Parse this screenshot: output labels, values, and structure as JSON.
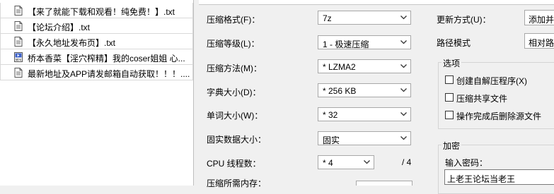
{
  "files": [
    {
      "name": "【来了就能下载和观看！纯免费！】.txt",
      "icon": "text-file-icon"
    },
    {
      "name": "【论坛介绍】.txt",
      "icon": "text-file-icon"
    },
    {
      "name": "【永久地址发布页】.txt",
      "icon": "text-file-icon"
    },
    {
      "name": "桥本香菜【淫穴榨精】我的coser姐姐 心...",
      "icon": "mp4-file-icon"
    },
    {
      "name": "最新地址及APP请发邮箱自动获取！！！....",
      "icon": "text-file-icon"
    }
  ],
  "settings": {
    "format": {
      "label": "压缩格式(F)：",
      "value": "7z"
    },
    "level": {
      "label": "压缩等级(L)：",
      "value": "1 - 极速压缩"
    },
    "method": {
      "label": "压缩方法(M)：",
      "value": "* LZMA2"
    },
    "dict": {
      "label": "字典大小(D)：",
      "value": "* 256 KB"
    },
    "word": {
      "label": "单词大小(W)：",
      "value": "* 32"
    },
    "solid": {
      "label": "固实数据大小：",
      "value": "固实"
    },
    "cpu": {
      "label": "CPU 线程数：",
      "value": "* 4",
      "max": "/ 4"
    },
    "memory": {
      "label": "压缩所需内存："
    }
  },
  "right": {
    "update": {
      "label": "更新方式(U)：",
      "value": "添加并"
    },
    "path": {
      "label": "路径模式",
      "value": "相对路"
    },
    "options": {
      "title": "选项",
      "items": [
        "创建自解压程序(X)",
        "压缩共享文件",
        "操作完成后删除源文件"
      ]
    },
    "encryption": {
      "title": "加密",
      "password_label": "输入密码：",
      "password_value": "上老王论坛当老王"
    }
  },
  "colors": {
    "accent": "#0a64c8",
    "border": "#a8a8a8"
  }
}
